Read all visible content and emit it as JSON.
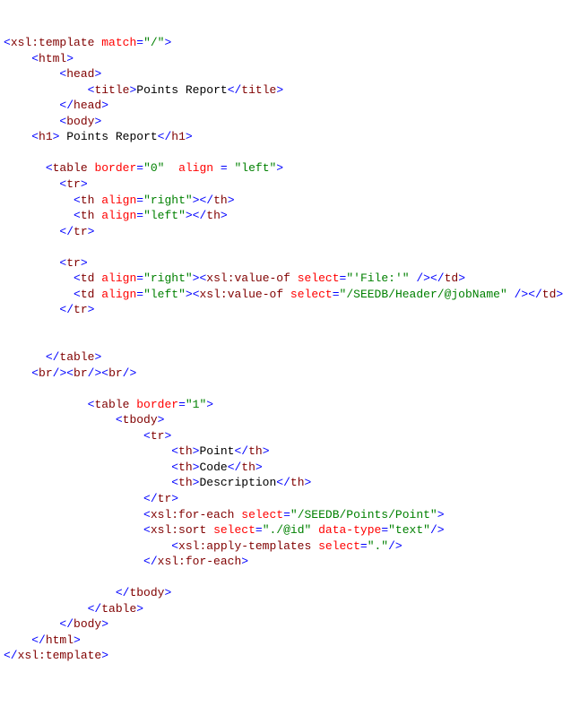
{
  "code": {
    "l01_a": "<",
    "l01_b": "xsl:template",
    "l01_c": " match",
    "l01_d": "=",
    "l01_e": "\"/\"",
    "l01_f": ">",
    "l02_a": "    ",
    "l02_b": "<",
    "l02_c": "html",
    "l02_d": ">",
    "l03_a": "        ",
    "l03_b": "<",
    "l03_c": "head",
    "l03_d": ">",
    "l04_a": "            ",
    "l04_b": "<",
    "l04_c": "title",
    "l04_d": ">",
    "l04_e": "Points Report",
    "l04_f": "</",
    "l04_g": "title",
    "l04_h": ">",
    "l05_a": "        ",
    "l05_b": "</",
    "l05_c": "head",
    "l05_d": ">",
    "l06_a": "        ",
    "l06_b": "<",
    "l06_c": "body",
    "l06_d": ">",
    "l07_a": "    ",
    "l07_b": "<",
    "l07_c": "h1",
    "l07_d": ">",
    "l07_e": " Points Report",
    "l07_f": "</",
    "l07_g": "h1",
    "l07_h": ">",
    "bl1": "",
    "l08_a": "      ",
    "l08_b": "<",
    "l08_c": "table",
    "l08_d": " border",
    "l08_e": "=",
    "l08_f": "\"0\"",
    "l08_g": "  align",
    "l08_h": " = ",
    "l08_i": "\"left\"",
    "l08_j": ">",
    "l09_a": "        ",
    "l09_b": "<",
    "l09_c": "tr",
    "l09_d": ">",
    "l10_a": "          ",
    "l10_b": "<",
    "l10_c": "th",
    "l10_d": " align",
    "l10_e": "=",
    "l10_f": "\"right\"",
    "l10_g": "></",
    "l10_h": "th",
    "l10_i": ">",
    "l11_a": "          ",
    "l11_b": "<",
    "l11_c": "th",
    "l11_d": " align",
    "l11_e": "=",
    "l11_f": "\"left\"",
    "l11_g": "></",
    "l11_h": "th",
    "l11_i": ">",
    "l12_a": "        ",
    "l12_b": "</",
    "l12_c": "tr",
    "l12_d": ">",
    "bl2": "",
    "l13_a": "        ",
    "l13_b": "<",
    "l13_c": "tr",
    "l13_d": ">",
    "l14_a": "          ",
    "l14_b": "<",
    "l14_c": "td",
    "l14_d": " align",
    "l14_e": "=",
    "l14_f": "\"right\"",
    "l14_g": ">",
    "l14_h": "<",
    "l14_i": "xsl:value-of",
    "l14_j": " select",
    "l14_k": "=",
    "l14_l": "\"'File:'\"",
    "l14_m": " />",
    "l14_n": "</",
    "l14_o": "td",
    "l14_p": ">",
    "l15_a": "          ",
    "l15_b": "<",
    "l15_c": "td",
    "l15_d": " align",
    "l15_e": "=",
    "l15_f": "\"left\"",
    "l15_g": ">",
    "l15_h": "<",
    "l15_i": "xsl:value-of",
    "l15_j": " select",
    "l15_k": "=",
    "l15_l": "\"/SEEDB/Header/@jobName\"",
    "l15_m": " />",
    "l15_n": "</",
    "l15_o": "td",
    "l15_p": ">",
    "l16_a": "        ",
    "l16_b": "</",
    "l16_c": "tr",
    "l16_d": ">",
    "bl3": "",
    "bl4": "",
    "l17_a": "      ",
    "l17_b": "</",
    "l17_c": "table",
    "l17_d": ">",
    "l18_a": "    ",
    "l18_b": "<",
    "l18_c": "br",
    "l18_d": "/><",
    "l18_e": "br",
    "l18_f": "/><",
    "l18_g": "br",
    "l18_h": "/>",
    "bl5": "",
    "l19_a": "            ",
    "l19_b": "<",
    "l19_c": "table",
    "l19_d": " border",
    "l19_e": "=",
    "l19_f": "\"1\"",
    "l19_g": ">",
    "l20_a": "                ",
    "l20_b": "<",
    "l20_c": "tbody",
    "l20_d": ">",
    "l21_a": "                    ",
    "l21_b": "<",
    "l21_c": "tr",
    "l21_d": ">",
    "l22_a": "                        ",
    "l22_b": "<",
    "l22_c": "th",
    "l22_d": ">",
    "l22_e": "Point",
    "l22_f": "</",
    "l22_g": "th",
    "l22_h": ">",
    "l23_a": "                        ",
    "l23_b": "<",
    "l23_c": "th",
    "l23_d": ">",
    "l23_e": "Code",
    "l23_f": "</",
    "l23_g": "th",
    "l23_h": ">",
    "l24_a": "                        ",
    "l24_b": "<",
    "l24_c": "th",
    "l24_d": ">",
    "l24_e": "Description",
    "l24_f": "</",
    "l24_g": "th",
    "l24_h": ">",
    "l25_a": "                    ",
    "l25_b": "</",
    "l25_c": "tr",
    "l25_d": ">",
    "l26_a": "                    ",
    "l26_b": "<",
    "l26_c": "xsl:for-each",
    "l26_d": " select",
    "l26_e": "=",
    "l26_f": "\"/SEEDB/Points/Point\"",
    "l26_g": ">",
    "l27_a": "                    ",
    "l27_b": "<",
    "l27_c": "xsl:sort",
    "l27_d": " select",
    "l27_e": "=",
    "l27_f": "\"./@id\"",
    "l27_g": " data-type",
    "l27_h": "=",
    "l27_i": "\"text\"",
    "l27_j": "/>",
    "l28_a": "                        ",
    "l28_b": "<",
    "l28_c": "xsl:apply-templates",
    "l28_d": " select",
    "l28_e": "=",
    "l28_f": "\".\"",
    "l28_g": "/>",
    "l29_a": "                    ",
    "l29_b": "</",
    "l29_c": "xsl:for-each",
    "l29_d": ">",
    "bl6": "",
    "l30_a": "                ",
    "l30_b": "</",
    "l30_c": "tbody",
    "l30_d": ">",
    "l31_a": "            ",
    "l31_b": "</",
    "l31_c": "table",
    "l31_d": ">",
    "l32_a": "        ",
    "l32_b": "</",
    "l32_c": "body",
    "l32_d": ">",
    "l33_a": "    ",
    "l33_b": "</",
    "l33_c": "html",
    "l33_d": ">",
    "l34_a": "</",
    "l34_b": "xsl:template",
    "l34_c": ">"
  }
}
